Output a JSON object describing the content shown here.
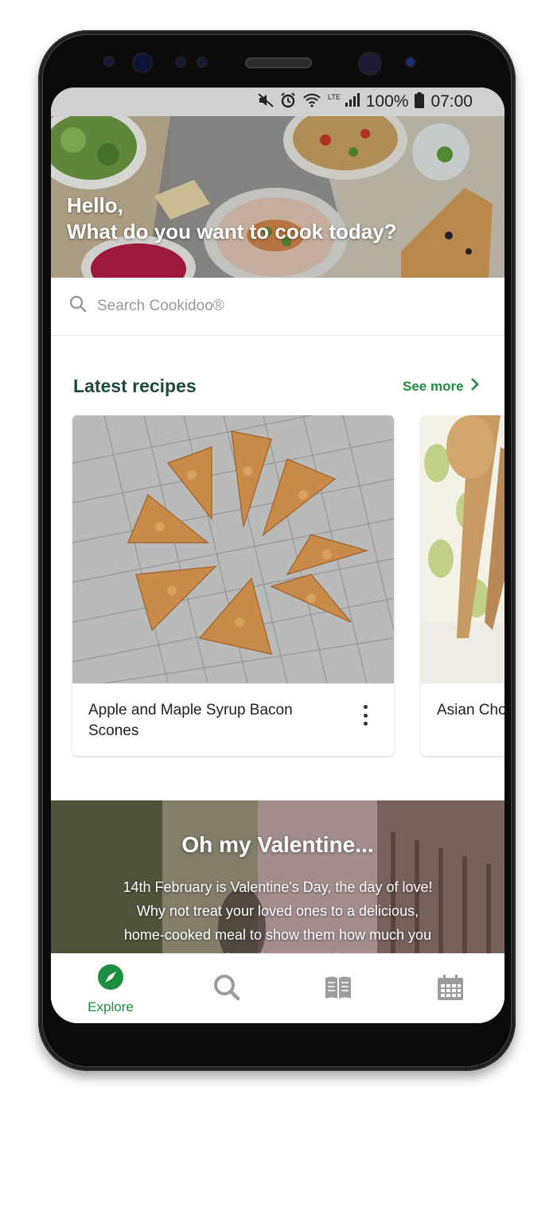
{
  "status_bar": {
    "icons": [
      "mute-icon",
      "alarm-icon",
      "wifi-icon",
      "lte-signal-icon",
      "battery-icon"
    ],
    "battery": "100%",
    "time": "07:00"
  },
  "hero": {
    "greeting_line1": "Hello,",
    "greeting_line2": "What do you want to cook today?"
  },
  "search": {
    "placeholder": "Search Cookidoo®"
  },
  "latest_recipes": {
    "title": "Latest recipes",
    "see_more": "See more",
    "cards": [
      {
        "title": "Apple and Maple Syrup Bacon Scones"
      },
      {
        "title": "Asian Cho"
      }
    ]
  },
  "banner": {
    "title": "Oh my Valentine...",
    "text": "14th February is Valentine's Day, the day of love! Why not treat your loved ones to a delicious, home-cooked meal to show them how much you care. After all, everyone knows"
  },
  "tabs": [
    {
      "label": "Explore",
      "icon": "compass-icon",
      "active": true
    },
    {
      "label": "",
      "icon": "search-icon",
      "active": false
    },
    {
      "label": "",
      "icon": "book-icon",
      "active": false
    },
    {
      "label": "",
      "icon": "calendar-icon",
      "active": false
    }
  ],
  "colors": {
    "accent": "#1a8f3e",
    "heading": "#1f4a38",
    "status_bar": "#cfd2d1"
  }
}
